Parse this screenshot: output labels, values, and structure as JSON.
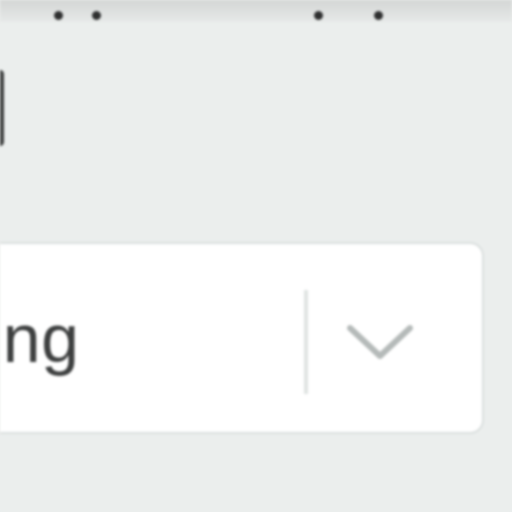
{
  "select": {
    "value": "menting"
  },
  "icons": {
    "dropdown": "chevron-down-icon"
  },
  "colors": {
    "background": "#ebeeed",
    "field_bg": "#ffffff",
    "text": "#3d3f3f"
  }
}
